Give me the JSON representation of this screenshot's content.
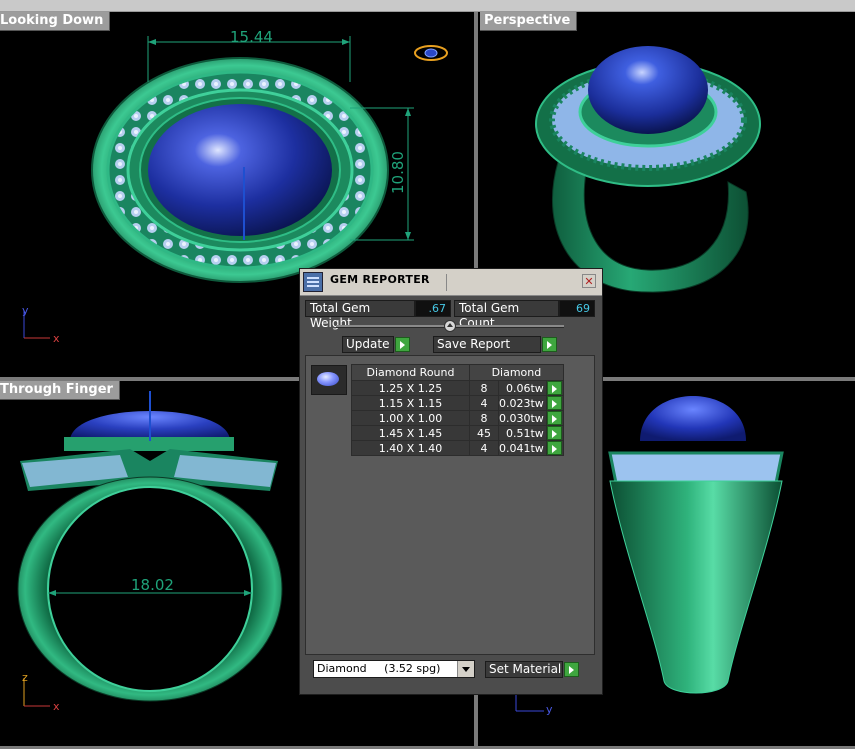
{
  "viewports": {
    "looking_down": {
      "title": "Looking Down",
      "dim_width": "15.44",
      "dim_height": "10.80",
      "axis_1": "y",
      "axis_2": "x"
    },
    "perspective": {
      "title": "Perspective"
    },
    "through_finger": {
      "title": "Through Finger",
      "dim_diameter": "18.02",
      "axis_1": "z",
      "axis_2": "x"
    },
    "side": {
      "axis_1": "y"
    }
  },
  "gem_reporter": {
    "title": "GEM REPORTER",
    "close_glyph": "✕",
    "total_weight_label": "Total Gem Weight",
    "total_weight_value": ".67",
    "total_count_label": "Total Gem Count",
    "total_count_value": "69",
    "update_label": "Update",
    "save_report_label": "Save Report",
    "table": {
      "header_shape": "Diamond Round",
      "header_material": "Diamond",
      "rows": [
        {
          "size": "1.25 X 1.25",
          "count": "8",
          "weight": "0.06tw"
        },
        {
          "size": "1.15 X 1.15",
          "count": "4",
          "weight": "0.023tw"
        },
        {
          "size": "1.00 X 1.00",
          "count": "8",
          "weight": "0.030tw"
        },
        {
          "size": "1.45 X 1.45",
          "count": "45",
          "weight": "0.51tw"
        },
        {
          "size": "1.40 X 1.40",
          "count": "4",
          "weight": "0.041tw"
        }
      ]
    },
    "material_select": "Diamond     (3.52 spg)",
    "set_material_label": "Set Material"
  },
  "colors": {
    "metal": "#1f8f5f",
    "metal_light": "#3fd09a",
    "gem": "#1f3aa8",
    "accent_dim": "#1fa37a"
  }
}
